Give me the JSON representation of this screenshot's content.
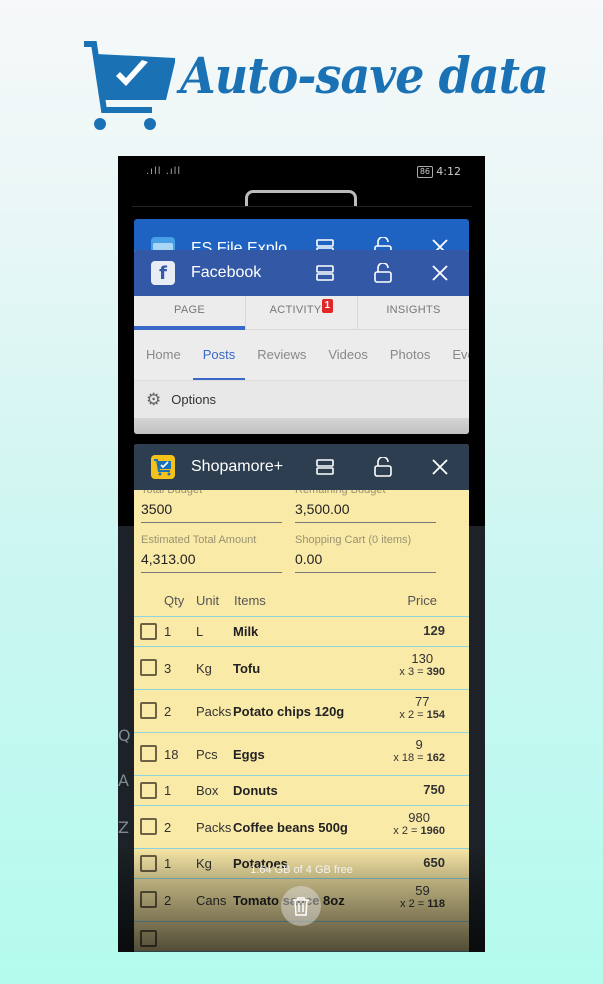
{
  "banner": {
    "title": "Auto-save data",
    "icon": "shopping-cart-check-icon",
    "color": "#1a72b5"
  },
  "statusbar": {
    "signal": ".ıll .ıll",
    "battery": "86",
    "time": "4:12"
  },
  "recents": {
    "cards": [
      {
        "app": "ES File Explo",
        "icon": "folder-icon",
        "color": "#1f63c2"
      },
      {
        "app": "Facebook",
        "icon": "facebook-icon",
        "color": "#3359a6",
        "tabs": [
          {
            "label": "PAGE",
            "active": true
          },
          {
            "label": "ACTIVITY",
            "badge": "1"
          },
          {
            "label": "INSIGHTS"
          }
        ],
        "nav": [
          {
            "label": "Home"
          },
          {
            "label": "Posts",
            "active": true
          },
          {
            "label": "Reviews"
          },
          {
            "label": "Videos"
          },
          {
            "label": "Photos"
          },
          {
            "label": "Eve"
          }
        ],
        "options_label": "Options"
      },
      {
        "app": "Shopamore+",
        "icon": "shopamore-cart-icon",
        "color": "#2c3e50"
      }
    ],
    "memory": "1.64 GB of 4 GB free",
    "clear_all_icon": "trash-icon"
  },
  "shop": {
    "total_budget": {
      "label": "Total Budget",
      "value": "3500"
    },
    "remaining_budget": {
      "label": "Remaining Budget",
      "value": "3,500.00"
    },
    "estimated_total": {
      "label": "Estimated Total Amount",
      "value": "4,313.00"
    },
    "cart": {
      "label": "Shopping Cart (0 items)",
      "value": "0.00"
    },
    "headers": {
      "qty": "Qty",
      "unit": "Unit",
      "items": "Items",
      "price": "Price"
    },
    "items": [
      {
        "qty": "1",
        "unit": "L",
        "name": "Milk",
        "price": "129"
      },
      {
        "qty": "3",
        "unit": "Kg",
        "name": "Tofu",
        "price": "130",
        "mult": "x 3 = ",
        "total": "390"
      },
      {
        "qty": "2",
        "unit": "Packs",
        "name": "Potato chips 120g",
        "price": "77",
        "mult": "x 2 = ",
        "total": "154"
      },
      {
        "qty": "18",
        "unit": "Pcs",
        "name": "Eggs",
        "price": "9",
        "mult": "x 18 = ",
        "total": "162"
      },
      {
        "qty": "1",
        "unit": "Box",
        "name": "Donuts",
        "price": "750"
      },
      {
        "qty": "2",
        "unit": "Packs",
        "name": "Coffee beans 500g",
        "price": "980",
        "mult": "x 2 = ",
        "total": "1960"
      },
      {
        "qty": "1",
        "unit": "Kg",
        "name": "Potatoes",
        "price": "650"
      },
      {
        "qty": "2",
        "unit": "Cans",
        "name": "Tomato sauce 8oz",
        "price": "59",
        "mult": "x 2 = ",
        "total": "118"
      }
    ]
  }
}
